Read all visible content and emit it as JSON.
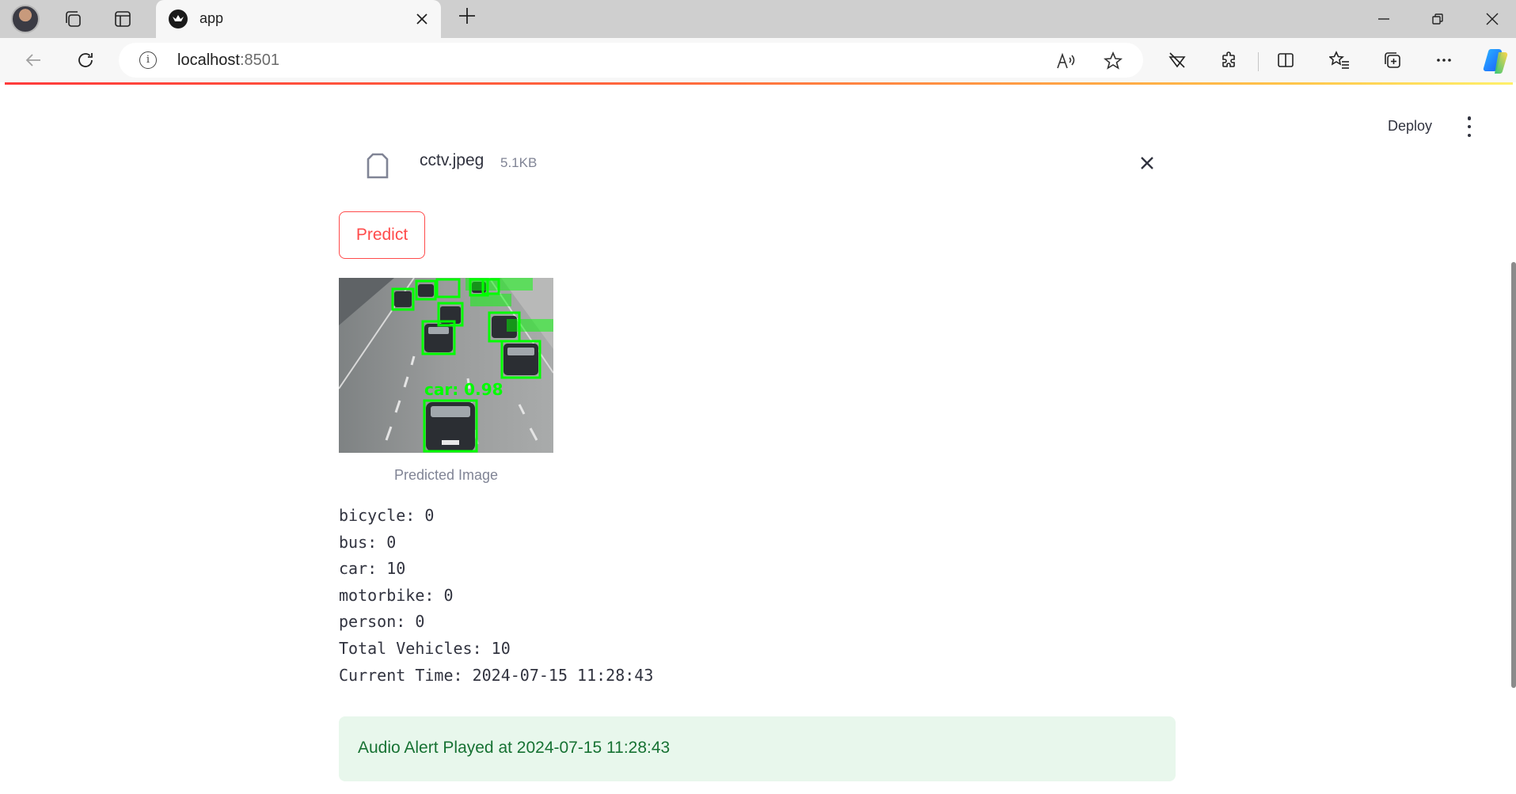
{
  "browser": {
    "tab_title": "app",
    "url_host": "localhost",
    "url_port": ":8501"
  },
  "app_header": {
    "deploy_label": "Deploy"
  },
  "uploaded_file": {
    "name": "cctv.jpeg",
    "size": "5.1KB"
  },
  "predict_button": {
    "label": "Predict"
  },
  "image": {
    "caption": "Predicted Image",
    "detection_label_visible": "car: 0.98"
  },
  "stats": [
    "bicycle: 0",
    "bus: 0",
    "car: 10",
    "motorbike: 0",
    "person: 0",
    "Total Vehicles: 10",
    "Current Time: 2024-07-15 11:28:43"
  ],
  "alert": {
    "text": "Audio Alert Played at 2024-07-15 11:28:43",
    "bg_color": "#e8f7ec",
    "text_color": "#177233"
  },
  "colors": {
    "accent": "#ff4b4b",
    "detection_box": "#00ff00"
  },
  "icons": [
    "profile-avatar",
    "workspaces-icon",
    "tab-actions-icon",
    "streamlit-favicon",
    "close-tab-icon",
    "new-tab-icon",
    "minimize-icon",
    "restore-icon",
    "close-window-icon",
    "back-icon",
    "refresh-icon",
    "info-icon",
    "read-aloud-icon",
    "favorite-star-icon",
    "tracking-icon",
    "extensions-icon",
    "split-screen-icon",
    "favorites-icon",
    "collections-icon",
    "more-icon",
    "copilot-icon",
    "file-icon",
    "remove-file-icon",
    "menu-kebab-icon"
  ]
}
